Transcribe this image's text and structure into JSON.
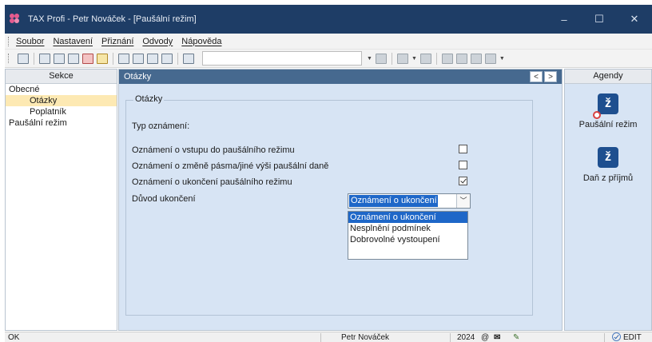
{
  "window": {
    "title": "TAX Profi - Petr Nováček - [Paušální režim]",
    "controls": {
      "minimize": "–",
      "maximize": "☐",
      "close": "✕"
    }
  },
  "menu": {
    "items": [
      "Soubor",
      "Nastavení",
      "Přiznání",
      "Odvody",
      "Nápověda"
    ]
  },
  "toolbar": {
    "combo_value": ""
  },
  "left_panel": {
    "header": "Sekce",
    "items": [
      {
        "label": "Obecné",
        "level": 0,
        "selected": false
      },
      {
        "label": "Otázky",
        "level": 1,
        "selected": true
      },
      {
        "label": "Poplatník",
        "level": 1,
        "selected": false
      },
      {
        "label": "Paušální režim",
        "level": 0,
        "selected": false
      }
    ]
  },
  "center": {
    "header": "Otázky",
    "nav_prev": "<",
    "nav_next": ">",
    "group_title": "Otázky",
    "type_label": "Typ oznámení:",
    "questions": [
      {
        "label": "Oznámení o vstupu do paušálního režimu",
        "checked": false
      },
      {
        "label": "Oznámení o změně pásma/jiné výši paušální daně",
        "checked": false
      },
      {
        "label": "Oznámení o ukončení paušálního režimu",
        "checked": true
      }
    ],
    "reason_label": "Důvod ukončení",
    "reason_value": "Oznámení o ukončení",
    "reason_options": [
      "Oznámení o ukončení",
      "Nesplnění podmínek",
      "Dobrovolné vystoupení"
    ]
  },
  "right_panel": {
    "header": "Agendy",
    "items": [
      {
        "label": "Paušální režim",
        "icon": "tax-agenda-icon"
      },
      {
        "label": "Daň z příjmů",
        "icon": "tax-agenda-icon"
      }
    ]
  },
  "status": {
    "left": "OK",
    "user": "Petr Nováček",
    "year": "2024",
    "mode": "EDIT"
  }
}
